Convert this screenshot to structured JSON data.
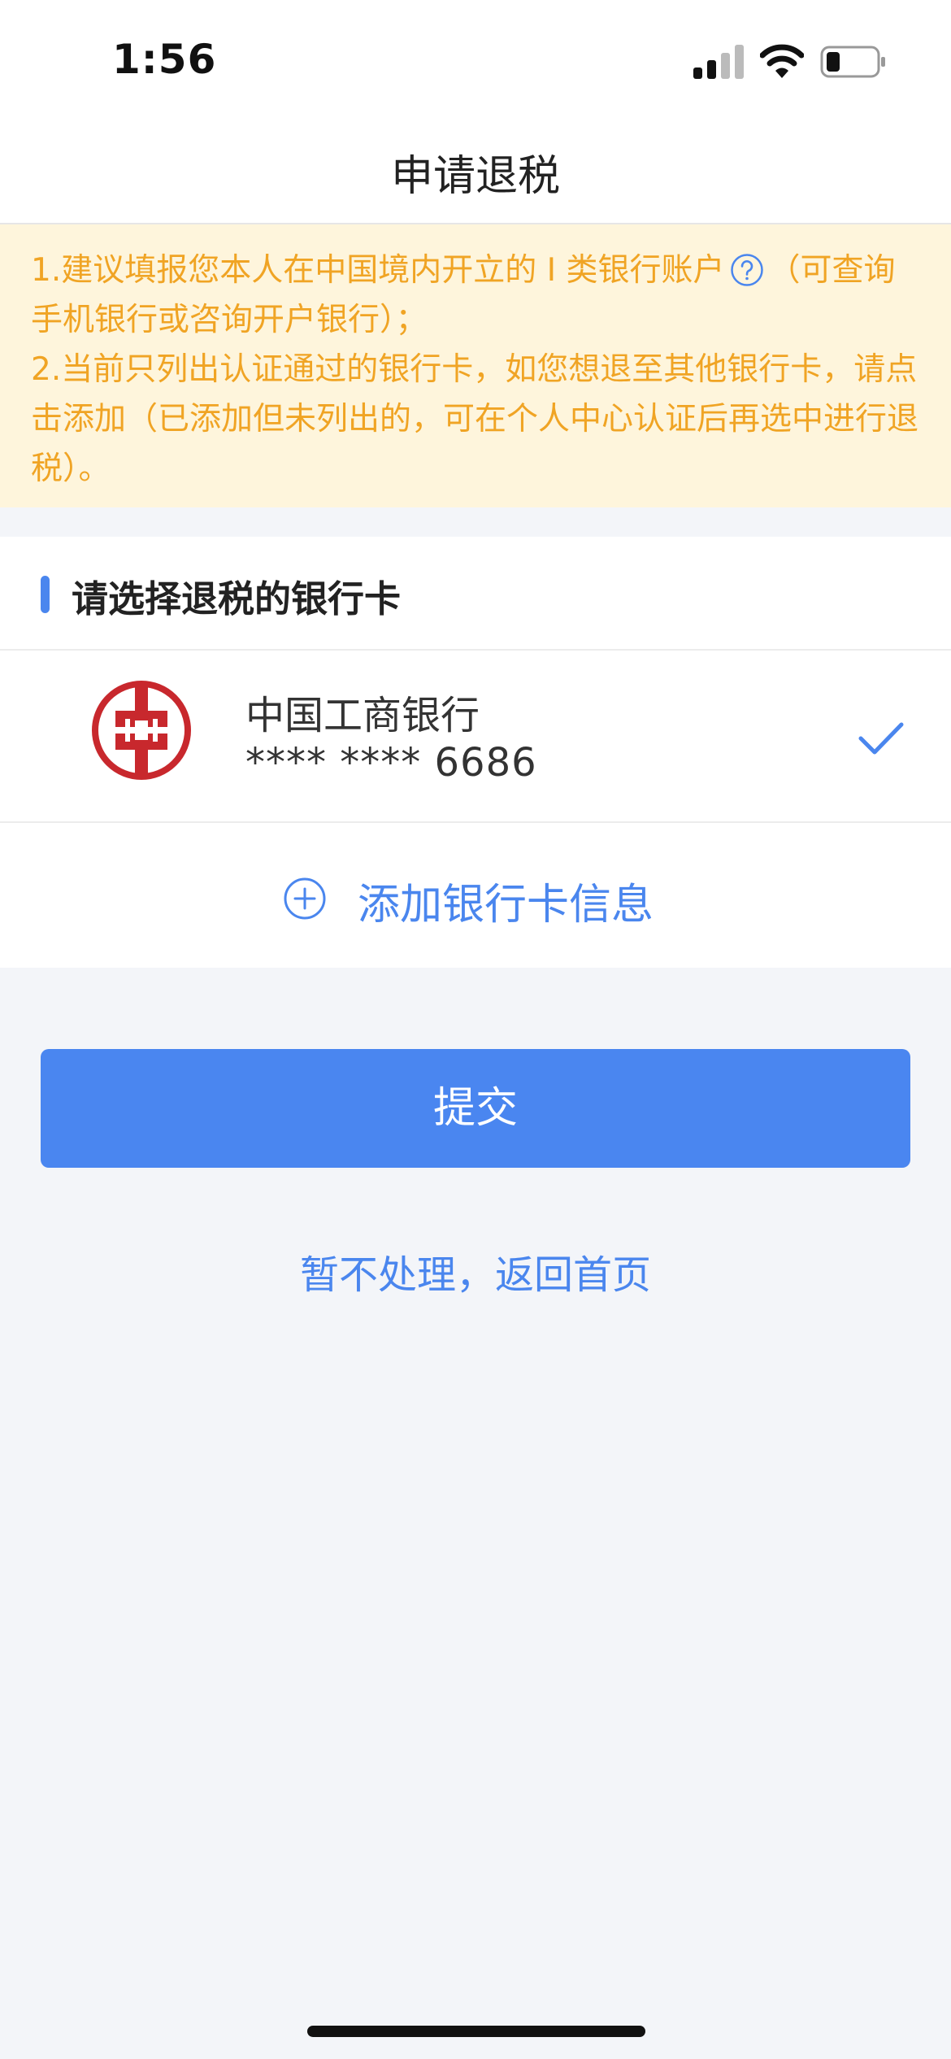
{
  "status_bar": {
    "time": "1:56"
  },
  "nav": {
    "title": "申请退税"
  },
  "notice": {
    "line1_before_icon": "1.建议填报您本人在中国境内开立的 I 类银行账户",
    "line1_after_icon": "（可查询手机银行或咨询开户银行）；",
    "line2": "2.当前只列出认证通过的银行卡，如您想退至其他银行卡，请点击添加（已添加但未列出的，可在个人中心认证后再选中进行退税）。"
  },
  "section": {
    "title": "请选择退税的银行卡"
  },
  "bank_cards": [
    {
      "bank_name": "中国工商银行",
      "card_number": "**** **** 6686",
      "selected": true
    }
  ],
  "add_card": {
    "label": "添加银行卡信息"
  },
  "submit": {
    "label": "提交"
  },
  "back_link": {
    "label": "暂不处理，返回首页"
  },
  "colors": {
    "accent": "#4a86f0",
    "notice_text": "#f0a424",
    "notice_bg": "#fef5dc",
    "bank_red": "#c8282d"
  }
}
